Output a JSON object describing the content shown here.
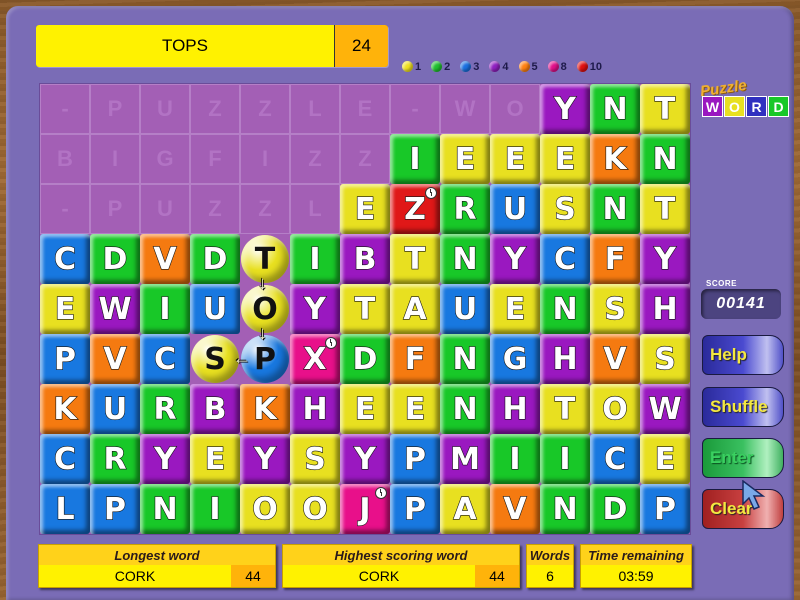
{
  "current_word": {
    "word": "TOPS",
    "score": "24"
  },
  "legend": [
    {
      "color": "#f0e020",
      "value": "1"
    },
    {
      "color": "#20c030",
      "value": "2"
    },
    {
      "color": "#1a70e0",
      "value": "3"
    },
    {
      "color": "#9020c0",
      "value": "4"
    },
    {
      "color": "#ff8010",
      "value": "5"
    },
    {
      "color": "#e0108a",
      "value": "8"
    },
    {
      "color": "#e01010",
      "value": "10"
    }
  ],
  "logo": {
    "top": "Puzzle",
    "letters": [
      "W",
      "O",
      "R",
      "D"
    ]
  },
  "colors": {
    "Y": "#e8e020",
    "G": "#18c828",
    "B": "#1878e0",
    "P": "#9a18c0",
    "O": "#f57a10",
    "K": "#e8108a",
    "R": "#e01818"
  },
  "board": {
    "ghost_rows": [
      [
        "-",
        "P",
        "U",
        "Z",
        "Z",
        "L",
        "E",
        "-",
        "W",
        "O"
      ],
      [
        "B",
        "I",
        "G",
        "F",
        "I",
        "Z",
        "Z"
      ],
      [
        "-",
        "P",
        "U",
        "Z",
        "Z",
        "L"
      ]
    ],
    "rows": [
      [
        null,
        null,
        null,
        null,
        null,
        null,
        null,
        null,
        null,
        null,
        {
          "l": "Y",
          "c": "P"
        },
        {
          "l": "N",
          "c": "G"
        },
        {
          "l": "T",
          "c": "Y"
        }
      ],
      [
        null,
        null,
        null,
        null,
        null,
        null,
        null,
        {
          "l": "I",
          "c": "G"
        },
        {
          "l": "E",
          "c": "Y"
        },
        {
          "l": "E",
          "c": "Y"
        },
        {
          "l": "E",
          "c": "Y"
        },
        {
          "l": "K",
          "c": "O"
        },
        {
          "l": "N",
          "c": "G"
        }
      ],
      [
        null,
        null,
        null,
        null,
        null,
        null,
        {
          "l": "E",
          "c": "Y"
        },
        {
          "l": "Z",
          "c": "R",
          "clock": true
        },
        {
          "l": "R",
          "c": "G"
        },
        {
          "l": "U",
          "c": "B"
        },
        {
          "l": "S",
          "c": "Y"
        },
        {
          "l": "N",
          "c": "G"
        },
        {
          "l": "T",
          "c": "Y"
        }
      ],
      [
        {
          "l": "C",
          "c": "B"
        },
        {
          "l": "D",
          "c": "G"
        },
        {
          "l": "V",
          "c": "O"
        },
        {
          "l": "D",
          "c": "G"
        },
        {
          "l": "T",
          "c": "Y",
          "sel": true
        },
        {
          "l": "I",
          "c": "G"
        },
        {
          "l": "B",
          "c": "P"
        },
        {
          "l": "T",
          "c": "Y"
        },
        {
          "l": "N",
          "c": "G"
        },
        {
          "l": "Y",
          "c": "P"
        },
        {
          "l": "C",
          "c": "B"
        },
        {
          "l": "F",
          "c": "O"
        },
        {
          "l": "Y",
          "c": "P"
        }
      ],
      [
        {
          "l": "E",
          "c": "Y"
        },
        {
          "l": "W",
          "c": "P"
        },
        {
          "l": "I",
          "c": "G"
        },
        {
          "l": "U",
          "c": "B"
        },
        {
          "l": "O",
          "c": "Y",
          "sel": true
        },
        {
          "l": "Y",
          "c": "P"
        },
        {
          "l": "T",
          "c": "Y"
        },
        {
          "l": "A",
          "c": "Y"
        },
        {
          "l": "U",
          "c": "B"
        },
        {
          "l": "E",
          "c": "Y"
        },
        {
          "l": "N",
          "c": "G"
        },
        {
          "l": "S",
          "c": "Y"
        },
        {
          "l": "H",
          "c": "P"
        }
      ],
      [
        {
          "l": "P",
          "c": "B"
        },
        {
          "l": "V",
          "c": "O"
        },
        {
          "l": "C",
          "c": "B"
        },
        {
          "l": "S",
          "c": "Y",
          "sel": true
        },
        {
          "l": "P",
          "c": "B",
          "sel": true
        },
        {
          "l": "X",
          "c": "K",
          "clock": true
        },
        {
          "l": "D",
          "c": "G"
        },
        {
          "l": "F",
          "c": "O"
        },
        {
          "l": "N",
          "c": "G"
        },
        {
          "l": "G",
          "c": "B"
        },
        {
          "l": "H",
          "c": "P"
        },
        {
          "l": "V",
          "c": "O"
        },
        {
          "l": "S",
          "c": "Y"
        }
      ],
      [
        {
          "l": "K",
          "c": "O"
        },
        {
          "l": "U",
          "c": "B"
        },
        {
          "l": "R",
          "c": "G"
        },
        {
          "l": "B",
          "c": "P"
        },
        {
          "l": "K",
          "c": "O"
        },
        {
          "l": "H",
          "c": "P"
        },
        {
          "l": "E",
          "c": "Y"
        },
        {
          "l": "E",
          "c": "Y"
        },
        {
          "l": "N",
          "c": "G"
        },
        {
          "l": "H",
          "c": "P"
        },
        {
          "l": "T",
          "c": "Y"
        },
        {
          "l": "O",
          "c": "Y"
        },
        {
          "l": "W",
          "c": "P"
        }
      ],
      [
        {
          "l": "C",
          "c": "B"
        },
        {
          "l": "R",
          "c": "G"
        },
        {
          "l": "Y",
          "c": "P"
        },
        {
          "l": "E",
          "c": "Y"
        },
        {
          "l": "Y",
          "c": "P"
        },
        {
          "l": "S",
          "c": "Y"
        },
        {
          "l": "Y",
          "c": "P"
        },
        {
          "l": "P",
          "c": "B"
        },
        {
          "l": "M",
          "c": "P"
        },
        {
          "l": "I",
          "c": "G"
        },
        {
          "l": "I",
          "c": "G"
        },
        {
          "l": "C",
          "c": "B"
        },
        {
          "l": "E",
          "c": "Y"
        }
      ],
      [
        {
          "l": "L",
          "c": "B"
        },
        {
          "l": "P",
          "c": "B"
        },
        {
          "l": "N",
          "c": "G"
        },
        {
          "l": "I",
          "c": "G"
        },
        {
          "l": "O",
          "c": "Y"
        },
        {
          "l": "O",
          "c": "Y"
        },
        {
          "l": "J",
          "c": "K",
          "clock": true
        },
        {
          "l": "P",
          "c": "B"
        },
        {
          "l": "A",
          "c": "Y"
        },
        {
          "l": "V",
          "c": "O"
        },
        {
          "l": "N",
          "c": "G"
        },
        {
          "l": "D",
          "c": "G"
        },
        {
          "l": "P",
          "c": "B"
        }
      ]
    ],
    "path": [
      [
        3,
        4
      ],
      [
        4,
        4
      ],
      [
        5,
        4
      ],
      [
        5,
        3
      ]
    ]
  },
  "score": {
    "label": "SCORE",
    "value": "00141"
  },
  "buttons": {
    "help": "Help",
    "shuffle": "Shuffle",
    "enter": "Enter",
    "clear": "Clear"
  },
  "stats": {
    "longest": {
      "label": "Longest word",
      "word": "CORK",
      "score": "44"
    },
    "highest": {
      "label": "Highest scoring word",
      "word": "CORK",
      "score": "44"
    },
    "words": {
      "label": "Words",
      "value": "6"
    },
    "time": {
      "label": "Time remaining",
      "value": "03:59"
    }
  }
}
